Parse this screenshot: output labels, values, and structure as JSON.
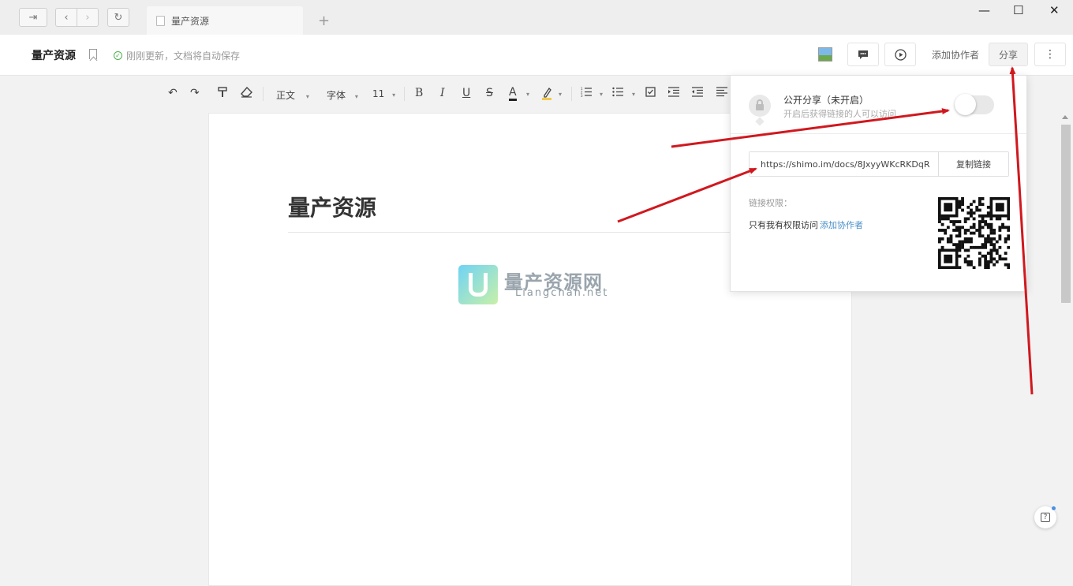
{
  "titlebar": {
    "tab_label": "量产资源",
    "new_tab_glyph": "+",
    "minimize_glyph": "—",
    "maximize_glyph": "☐",
    "close_glyph": "✕"
  },
  "header": {
    "doc_title": "量产资源",
    "save_status": "刚刚更新，文档将自动保存",
    "add_collaborator": "添加协作者",
    "share": "分享",
    "more_glyph": "⋮"
  },
  "toolbar": {
    "style_select": "正文",
    "font_select": "字体",
    "size_select": "11",
    "bold": "B",
    "italic": "I",
    "underline": "U",
    "strike": "S",
    "font_color": "A"
  },
  "document": {
    "heading": "量产资源",
    "logo_cn": "量产资源网",
    "logo_en": "Liangchan.net"
  },
  "share_panel": {
    "public_title": "公开分享（未开启）",
    "public_subtitle": "开启后获得链接的人可以访问",
    "link_url": "https://shimo.im/docs/8JxyyWKcRKDqR",
    "copy_link": "复制链接",
    "permission_label": "链接权限：",
    "permission_text": "只有我有权限访问",
    "permission_add": "添加协作者",
    "toggle_enabled": false
  },
  "colors": {
    "accent_link": "#4a90c8",
    "annotation_arrow": "#d0181e"
  }
}
